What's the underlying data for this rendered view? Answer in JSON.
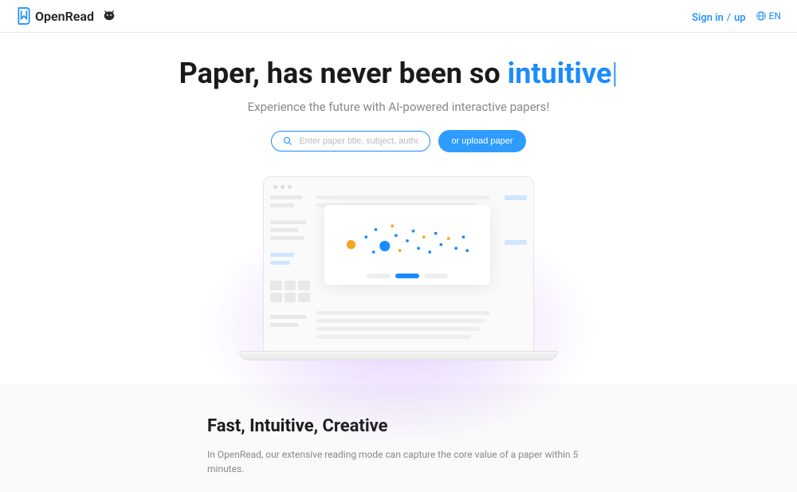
{
  "header": {
    "brand": "OpenRead",
    "signin": "Sign in",
    "signup": "up",
    "sep": "/",
    "lang": "EN"
  },
  "hero": {
    "title_prefix": "Paper, has never been so ",
    "title_accent": "intuitive",
    "cursor": "|",
    "subtitle": "Experience the future with AI-powered interactive papers!",
    "search_placeholder": "Enter paper title, subject, author, ...",
    "upload_label": "or upload paper"
  },
  "section2": {
    "title": "Fast, Intuitive, Creative",
    "text": "In OpenRead, our extensive reading mode can capture the core value of a paper within 5 minutes."
  }
}
